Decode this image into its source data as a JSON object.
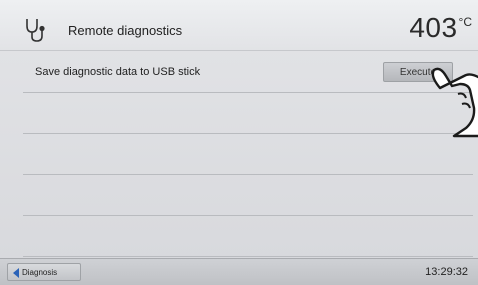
{
  "header": {
    "title": "Remote diagnostics",
    "icon": "stethoscope-icon",
    "temperature": {
      "value": "403",
      "unit": "°C"
    }
  },
  "list": {
    "items": [
      {
        "label": "Save diagnostic data to USB stick",
        "button_label": "Execute"
      },
      {
        "label": ""
      },
      {
        "label": ""
      },
      {
        "label": ""
      },
      {
        "label": ""
      }
    ]
  },
  "footer": {
    "back_label": "Diagnosis",
    "time": "13:29:32"
  },
  "colors": {
    "accent": "#2b63b8",
    "background": "#dcdde0"
  }
}
